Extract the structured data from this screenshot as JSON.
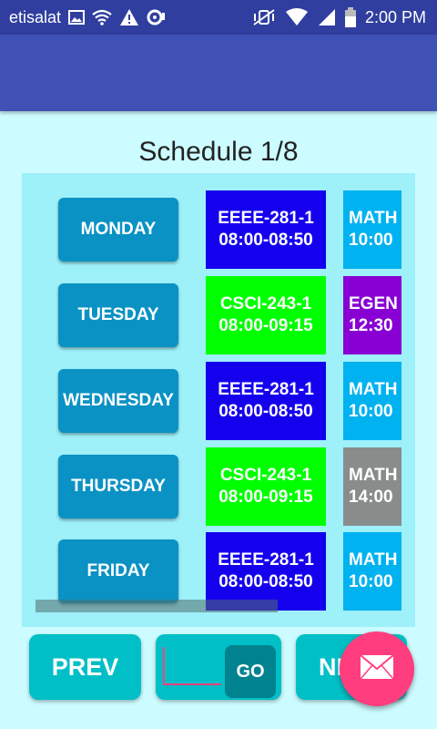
{
  "status": {
    "carrier": "etisalat",
    "time": "2:00 PM"
  },
  "title": "Schedule 1/8",
  "days": [
    {
      "label": "MONDAY",
      "c1": {
        "course": "EEEE-281-1",
        "time": "08:00-08:50",
        "color": "#1500ee"
      },
      "c2": {
        "course": "MATH",
        "time": "10:00",
        "color": "#00b2f0"
      }
    },
    {
      "label": "TUESDAY",
      "c1": {
        "course": "CSCI-243-1",
        "time": "08:00-09:15",
        "color": "#00ff00"
      },
      "c2": {
        "course": "EGEN",
        "time": "12:30",
        "color": "#8800d4"
      }
    },
    {
      "label": "WEDNESDAY",
      "c1": {
        "course": "EEEE-281-1",
        "time": "08:00-08:50",
        "color": "#1500ee"
      },
      "c2": {
        "course": "MATH",
        "time": "10:00",
        "color": "#00b2f0"
      }
    },
    {
      "label": "THURSDAY",
      "c1": {
        "course": "CSCI-243-1",
        "time": "08:00-09:15",
        "color": "#00ff00"
      },
      "c2": {
        "course": "MATH",
        "time": "14:00",
        "color": "#888d8c"
      }
    },
    {
      "label": "FRIDAY",
      "c1": {
        "course": "EEEE-281-1",
        "time": "08:00-08:50",
        "color": "#1500ee"
      },
      "c2": {
        "course": "MATH",
        "time": "10:00",
        "color": "#00b2f0"
      }
    }
  ],
  "buttons": {
    "prev": "PREV",
    "go": "GO",
    "next": "NEXT"
  },
  "page_input": {
    "value": "",
    "placeholder": ""
  },
  "icons": {
    "fab": "mail-icon"
  }
}
